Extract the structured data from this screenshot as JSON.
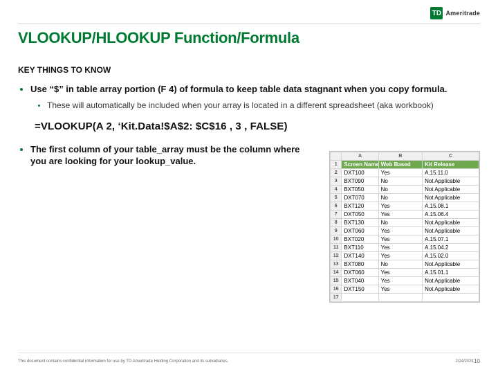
{
  "logo": {
    "mark": "TD",
    "brand": "Ameritrade"
  },
  "title": "VLOOKUP/HLOOKUP Function/Formula",
  "subtitle": "KEY THINGS TO KNOW",
  "bullets": {
    "b1": "Use “$” in table array portion (F 4) of formula to keep table data stagnant when you copy formula.",
    "b1_sub": "These will automatically be included when your array is located in a different spreadsheet (aka workbook)",
    "b2": "The first column of your table_array must be the column where you are looking for your lookup_value."
  },
  "formula": "=VLOOKUP(A 2, ‘Kit.Data!$A$2: $C$16 , 3 , FALSE)",
  "sheet": {
    "col_labels": [
      "A",
      "B",
      "C"
    ],
    "headers": [
      "Screen Name",
      "Web Based",
      "Kit Release"
    ],
    "rows": [
      {
        "n": "2",
        "a": "DXT100",
        "b": "Yes",
        "c": "A.15.11.0"
      },
      {
        "n": "3",
        "a": "BXT090",
        "b": "No",
        "c": "Not Applicable"
      },
      {
        "n": "4",
        "a": "BXT050",
        "b": "No",
        "c": "Not Applicable"
      },
      {
        "n": "5",
        "a": "DXT070",
        "b": "No",
        "c": "Not Applicable"
      },
      {
        "n": "6",
        "a": "BXT120",
        "b": "Yes",
        "c": "A.15.08.1"
      },
      {
        "n": "7",
        "a": "DXT050",
        "b": "Yes",
        "c": "A.15.06.4"
      },
      {
        "n": "8",
        "a": "BXT130",
        "b": "No",
        "c": "Not Applicable"
      },
      {
        "n": "9",
        "a": "DXT060",
        "b": "Yes",
        "c": "Not Applicable"
      },
      {
        "n": "10",
        "a": "BXT020",
        "b": "Yes",
        "c": "A.15.07.1"
      },
      {
        "n": "11",
        "a": "BXT110",
        "b": "Yes",
        "c": "A.15.04.2"
      },
      {
        "n": "12",
        "a": "DXT140",
        "b": "Yes",
        "c": "A.15.02.0"
      },
      {
        "n": "13",
        "a": "BXT080",
        "b": "No",
        "c": "Not Applicable"
      },
      {
        "n": "14",
        "a": "DXT060",
        "b": "Yes",
        "c": "A.15.01.1"
      },
      {
        "n": "15",
        "a": "BXT040",
        "b": "Yes",
        "c": "Not Applicable"
      },
      {
        "n": "16",
        "a": "DXT150",
        "b": "Yes",
        "c": "Not Applicable"
      },
      {
        "n": "17",
        "a": "",
        "b": "",
        "c": ""
      }
    ]
  },
  "footer": {
    "confidential": "This document contains confidential information for use by TD Ameritrade Holding Corporation and its subsidiaries.",
    "date": "2/24/2021",
    "page": "10"
  }
}
